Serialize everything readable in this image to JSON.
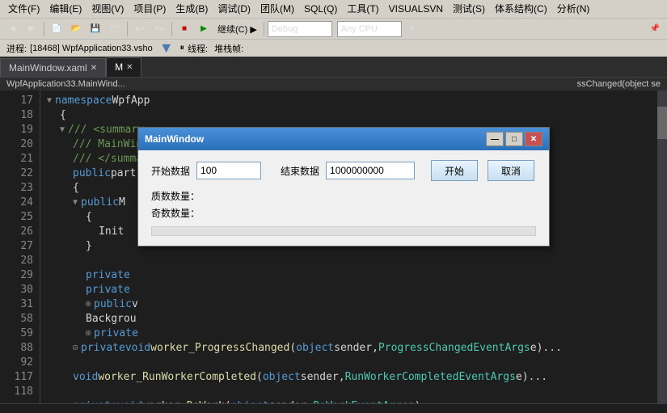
{
  "menubar": {
    "items": [
      "文件(F)",
      "编辑(E)",
      "视图(V)",
      "项目(P)",
      "生成(B)",
      "调试(D)",
      "团队(M)",
      "SQL(Q)",
      "工具(T)",
      "VISUALSVN",
      "测试(S)",
      "体系结构(C)",
      "分析(N)"
    ]
  },
  "toolbar": {
    "debug_config": "Debug",
    "cpu_config": "Any CPU",
    "continue_label": "继续(C) ▶"
  },
  "status": {
    "process_label": "进程:",
    "process_value": "[18468] WpfApplication33.vsho",
    "thread_label": "线程:",
    "stack_label": "堆栈帧:"
  },
  "tabs": [
    {
      "label": "MainWindow.xaml",
      "active": false
    },
    {
      "label": "M",
      "active": true
    }
  ],
  "breadcrumb": "WpfApplication33.MainWind...",
  "right_breadcrumb": "ssChanged(object se",
  "code_lines": [
    {
      "num": "17",
      "indent": 0,
      "has_expand": true,
      "expand_open": true,
      "content": "namespace WpfApp"
    },
    {
      "num": "18",
      "indent": 1,
      "content": "{"
    },
    {
      "num": "19",
      "indent": 2,
      "has_expand": true,
      "expand_open": true,
      "content": "/// <summary>"
    },
    {
      "num": "20",
      "indent": 2,
      "content": "/// MainWind"
    },
    {
      "num": "21",
      "indent": 2,
      "content": "/// </summar"
    },
    {
      "num": "22",
      "indent": 2,
      "content": "public part"
    },
    {
      "num": "23",
      "indent": 2,
      "content": "{"
    },
    {
      "num": "24",
      "indent": 3,
      "has_expand": true,
      "expand_open": true,
      "content": "public M"
    },
    {
      "num": "25",
      "indent": 3,
      "content": "{"
    },
    {
      "num": "26",
      "indent": 4,
      "content": "Init"
    },
    {
      "num": "27",
      "indent": 3,
      "content": "}"
    },
    {
      "num": "28",
      "indent": 2,
      "content": ""
    },
    {
      "num": "29",
      "indent": 3,
      "content": "private"
    },
    {
      "num": "30",
      "indent": 3,
      "content": "private"
    },
    {
      "num": "31",
      "indent": 3,
      "has_expand": false,
      "content": "public v"
    },
    {
      "num": "58",
      "indent": 3,
      "content": "Backgrou"
    },
    {
      "num": "59",
      "indent": 3,
      "has_expand": false,
      "content": "private"
    },
    {
      "num": "88",
      "indent": 2,
      "content": "private void worker_ProgressChanged(object sender, ProgressChangedEventArgs e)..."
    },
    {
      "num": "92",
      "indent": 2,
      "content": ""
    },
    {
      "num": "",
      "indent": 2,
      "content": "void worker_RunWorkerCompleted(object sender, RunWorkerCompletedEventArgs e)..."
    },
    {
      "num": "117",
      "indent": 2,
      "content": ""
    },
    {
      "num": "118",
      "indent": 2,
      "content": "private void worker_DoWork(object sender, DoWorkEventArgs e)..."
    }
  ],
  "modal": {
    "title": "MainWindow",
    "controls": {
      "min": "—",
      "max": "□",
      "close": "✕"
    },
    "fields": {
      "start_label": "开始数据",
      "start_value": "100",
      "end_label": "结束数据",
      "end_value": "1000000000"
    },
    "buttons": {
      "start": "开始",
      "cancel": "取消"
    },
    "stats": {
      "prime_label": "质数数量：",
      "odd_label": "奇数数量："
    }
  }
}
